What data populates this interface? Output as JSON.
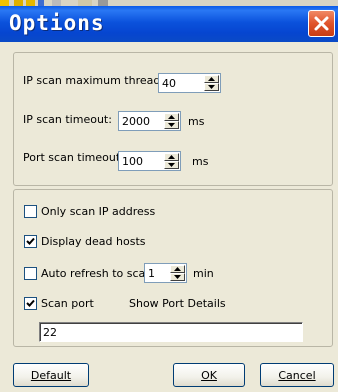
{
  "window": {
    "title": "Options"
  },
  "ip_scan": {
    "max_threads_label": "IP scan maximum threads:",
    "max_threads_value": "40",
    "timeout_label": "IP scan timeout:",
    "timeout_value": "2000",
    "timeout_unit": "ms"
  },
  "port_scan": {
    "timeout_label": "Port scan timeout:",
    "timeout_value": "100",
    "timeout_unit": "ms"
  },
  "options": {
    "only_scan_ip": {
      "label": "Only scan IP address",
      "checked": false
    },
    "display_dead_hosts": {
      "label": "Display dead hosts",
      "checked": true
    },
    "auto_refresh": {
      "label": "Auto refresh to scan",
      "checked": false,
      "value": "1",
      "unit": "min"
    },
    "scan_port": {
      "label": "Scan port",
      "checked": true
    },
    "show_port_details_label": "Show Port Details",
    "ports_value": "22"
  },
  "buttons": {
    "default_label": "Default",
    "ok_label": "OK",
    "cancel_label": "Cancel"
  },
  "icons": {
    "close": "close-icon",
    "spin_up": "arrow-up-icon",
    "spin_down": "arrow-down-icon",
    "check": "checkmark-icon"
  }
}
